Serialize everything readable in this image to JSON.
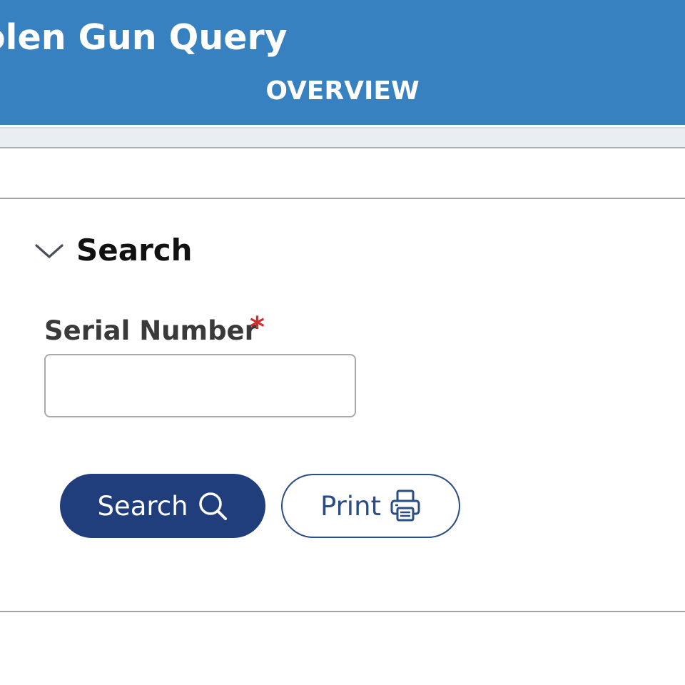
{
  "header": {
    "title": "olen Gun Query",
    "tab": "OVERVIEW",
    "background_color": "#3781c1"
  },
  "search_panel": {
    "title": "Search",
    "toggle_icon": "chevron-down-icon",
    "expanded": true
  },
  "form": {
    "serial_number": {
      "label": "Serial Number",
      "required_marker": "*",
      "value": "",
      "placeholder": ""
    }
  },
  "actions": {
    "search": {
      "label": "Search",
      "icon": "search-icon",
      "color": "#203d7c"
    },
    "print": {
      "label": "Print",
      "icon": "printer-icon",
      "color": "#2a4d86"
    }
  }
}
